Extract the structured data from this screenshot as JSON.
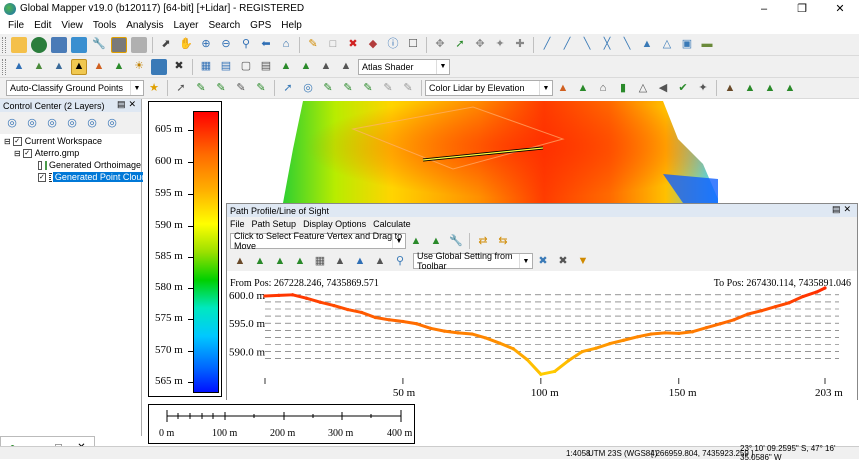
{
  "window": {
    "title": "Global Mapper v19.0 (b120117) [64-bit] [+Lidar] - REGISTERED"
  },
  "menu": [
    "File",
    "Edit",
    "View",
    "Tools",
    "Analysis",
    "Layer",
    "Search",
    "GPS",
    "Help"
  ],
  "toolbar2": {
    "shader_combo": "Atlas Shader"
  },
  "toolbar3": {
    "classify_combo": "Auto-Classify Ground Points",
    "lidar_color_combo": "Color Lidar by Elevation"
  },
  "control_center": {
    "title": "Control Center (2 Layers)",
    "tree": [
      {
        "label": "Current Workspace",
        "checked": true
      },
      {
        "label": "Aterro.gmp",
        "checked": true
      },
      {
        "label": "Generated Orthoimage",
        "checked": false
      },
      {
        "label": "Generated Point Cloud (",
        "checked": true
      }
    ]
  },
  "elevation_legend": {
    "labels": [
      "605 m",
      "600 m",
      "595 m",
      "590 m",
      "585 m",
      "580 m",
      "575 m",
      "570 m",
      "565 m"
    ]
  },
  "scale_bar": {
    "labels": [
      "0 m",
      "100 m",
      "200 m",
      "300 m",
      "400 m"
    ]
  },
  "path_profile": {
    "title": "Path Profile/Line of Sight",
    "menu": [
      "File",
      "Path Setup",
      "Display Options",
      "Calculate"
    ],
    "mode_combo": "Click to Select Feature Vertex and Drag to Move",
    "setting_combo": "Use Global Setting from Toolbar",
    "from_pos": "From Pos: 267228.246, 7435869.571",
    "to_pos": "To Pos: 267430.114, 7435891.046"
  },
  "chart_data": {
    "type": "line",
    "title": "",
    "xlabel": "",
    "ylabel": "",
    "xlim": [
      0,
      203
    ],
    "ylim": [
      585.7,
      601.2
    ],
    "x_tick_labels": [
      "50 m",
      "100 m",
      "150 m",
      "203 m"
    ],
    "x_ticks": [
      50,
      100,
      150,
      203
    ],
    "y_tick_labels": [
      "600.0 m",
      "595.0 m",
      "590.0 m"
    ],
    "y_ticks": [
      600,
      595,
      590
    ],
    "series": [
      {
        "x": [
          0,
          5,
          10,
          15,
          20,
          25,
          30,
          35,
          40,
          45,
          50,
          55,
          60,
          65,
          70,
          75,
          80,
          85,
          90,
          95,
          100,
          105,
          110,
          115,
          120,
          125,
          130,
          135,
          140,
          145,
          150,
          155,
          160,
          165,
          170,
          175,
          180,
          185,
          190,
          195,
          200,
          203
        ],
        "y": [
          599.8,
          599.9,
          600.0,
          599.4,
          598.7,
          598.1,
          597.4,
          596.9,
          596.0,
          595.6,
          595.3,
          594.9,
          594.1,
          593.6,
          593.3,
          593.1,
          592.4,
          591.5,
          590.5,
          588.6,
          586.0,
          586.5,
          588.4,
          590.0,
          590.6,
          591.4,
          592.0,
          592.6,
          593.1,
          593.3,
          593.2,
          593.5,
          594.2,
          594.9,
          595.6,
          596.6,
          597.2,
          597.9,
          598.6,
          599.7,
          600.5,
          601.2
        ]
      }
    ]
  },
  "status_bar": {
    "scale": "1:4058",
    "projection": "UTM 23S (WGS84)",
    "coords": "[ 266959.804, 7435923.259 ]",
    "latlon": "23° 10' 09.2595\" S, 47° 16' 35.0586\" W"
  }
}
